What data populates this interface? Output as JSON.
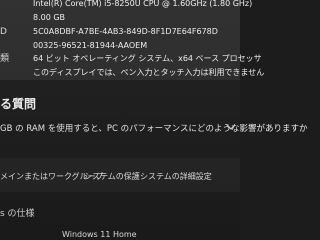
{
  "spec": {
    "rows": [
      {
        "label": "",
        "value": "Intel(R) Core(TM) i5-8250U CPU @ 1.60GHz (1.80 GHz)"
      },
      {
        "label": "",
        "value": "8.00 GB"
      },
      {
        "label": "D",
        "value": "5C0A8DBF-A7BE-4AB3-849D-8F1D7E64F678D"
      },
      {
        "label": "",
        "value": "00325-96521-81944-AAOEM"
      },
      {
        "label": "類",
        "value": "64 ビット オペレーティング システム、x64 ベース プロセッサ"
      },
      {
        "label": "",
        "value": "このディスプレイでは、ペン入力とタッチ入力は利用できません"
      }
    ]
  },
  "faq": {
    "heading": "る質問",
    "question": "GB の RAM を使用すると、PC のパフォーマンスにどのような影響がありますか"
  },
  "links": {
    "domain": "メインまたはワークグループ",
    "protection": "システムの保護",
    "advanced": "システムの詳細設定"
  },
  "windows_spec": {
    "heading": "s の仕様",
    "edition_label": "",
    "edition_value": "Windows 11 Home"
  },
  "colors": {
    "background": "#1c1c1c",
    "panel": "#2b2b2b"
  }
}
